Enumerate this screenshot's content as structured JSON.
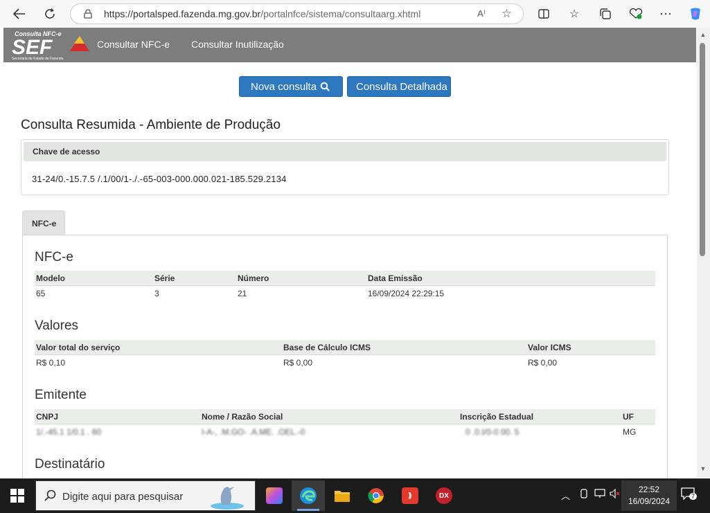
{
  "browser": {
    "url_host": "https://portalsped.fazenda.mg.gov.br",
    "url_path": "/portalnfce/sistema/consultaarg.xhtml",
    "read_aloud_label": "A⁾"
  },
  "site": {
    "logo_top_text": "Consulta NFC-e",
    "logo_main_text": "SEF",
    "logo_sub_text": "Secretaria de Estado de Fazenda",
    "nav": [
      "Consultar NFC-e",
      "Consultar Inutilização"
    ]
  },
  "actions": {
    "new_query": "Nova consulta",
    "detailed_query": "Consulta Detalhada"
  },
  "page_title": "Consulta Resumida - Ambiente de Produção",
  "access_key": {
    "label": "Chave de acesso",
    "value": "31-24/0.-15.7.5 /.1/00/1-./.-65-003-000.000.021-185.529.2134"
  },
  "tab_label": "NFC-e",
  "nfce": {
    "title": "NFC-e",
    "headers": [
      "Modelo",
      "Série",
      "Número",
      "Data Emissão"
    ],
    "values": [
      "65",
      "3",
      "21",
      "16/09/2024 22:29:15"
    ]
  },
  "valores": {
    "title": "Valores",
    "headers": [
      "Valor total do serviço",
      "Base de Cálculo ICMS",
      "Valor ICMS"
    ],
    "values": [
      "R$ 0,10",
      "R$ 0,00",
      "R$ 0,00"
    ]
  },
  "emitente": {
    "title": "Emitente",
    "headers": [
      "CNPJ",
      "Nome / Razão Social",
      "Inscrição Estadual",
      "UF"
    ],
    "values": [
      "1/.-45.1 1/0.1 . 60",
      "I-A-, .M.GO- .A.ME. .OEL.-0",
      "0 .0.I/0-0 00. 5",
      "MG"
    ]
  },
  "destinatario": {
    "title": "Destinatário"
  },
  "taskbar": {
    "search_placeholder": "Digite aqui para pesquisar",
    "time": "22:52",
    "date": "16/09/2024",
    "notifications": "7"
  },
  "colors": {
    "header_bg": "#7d7d7d",
    "button_blue": "#2e78c0",
    "table_header_bg": "#e9efe8",
    "logo_red": "#d62b2b"
  }
}
